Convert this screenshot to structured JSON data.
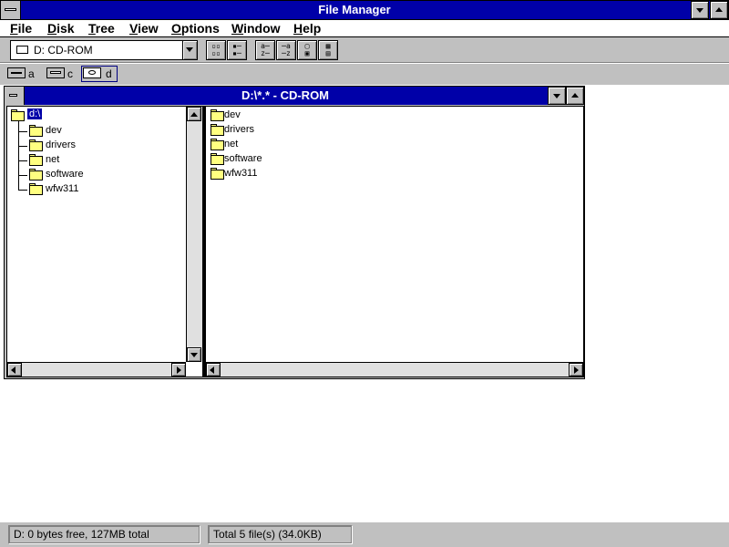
{
  "window": {
    "title": "File Manager"
  },
  "menu": [
    {
      "hot": "F",
      "rest": "ile"
    },
    {
      "hot": "D",
      "rest": "isk"
    },
    {
      "hot": "T",
      "rest": "ree"
    },
    {
      "hot": "V",
      "rest": "iew"
    },
    {
      "hot": "O",
      "rest": "ptions"
    },
    {
      "hot": "W",
      "rest": "indow"
    },
    {
      "hot": "H",
      "rest": "elp"
    }
  ],
  "toolbar": {
    "drive_select": "D: CD-ROM",
    "tools": [
      "connect-network-drive",
      "disconnect-network-drive",
      "view-name",
      "view-details",
      "sort-by-name",
      "sort-by-type",
      "copy-disk",
      "label-disk"
    ]
  },
  "drives": [
    {
      "letter": "a",
      "icon": "floppy-drive-icon"
    },
    {
      "letter": "c",
      "icon": "hard-drive-icon"
    },
    {
      "letter": "d",
      "icon": "cdrom-drive-icon",
      "selected": true
    }
  ],
  "child_window": {
    "title": "D:\\*.* - CD-ROM",
    "tree_root": "d:\\",
    "tree_items": [
      "dev",
      "drivers",
      "net",
      "software",
      "wfw311"
    ],
    "files": [
      "dev",
      "drivers",
      "net",
      "software",
      "wfw311"
    ]
  },
  "status": {
    "left": "D: 0 bytes free,  127MB total",
    "right": "Total 5 file(s) (34.0KB)"
  },
  "colors": {
    "titlebar": "#0000a8",
    "chrome": "#c0c0c0",
    "folder": "#ffff80"
  }
}
